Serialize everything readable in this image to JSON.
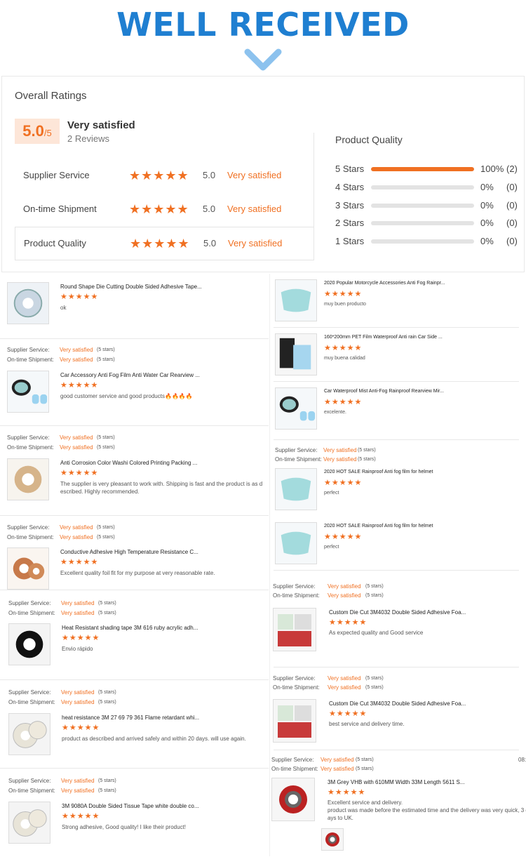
{
  "banner": {
    "title": "WELL RECEIVED"
  },
  "ratings": {
    "title": "Overall Ratings",
    "score": "5.0",
    "score_max": "/5",
    "summary": "Very satisfied",
    "review_count": "2 Reviews",
    "metrics": [
      {
        "label": "Supplier Service",
        "stars": "★★★★★",
        "score": "5.0",
        "text": "Very satisfied"
      },
      {
        "label": "On-time Shipment",
        "stars": "★★★★★",
        "score": "5.0",
        "text": "Very satisfied"
      },
      {
        "label": "Product Quality",
        "stars": "★★★★★",
        "score": "5.0",
        "text": "Very satisfied"
      }
    ],
    "product_quality": {
      "title": "Product Quality",
      "rows": [
        {
          "label": "5 Stars",
          "fraction": 1.0,
          "pct": "100%",
          "count": "(2)"
        },
        {
          "label": "4 Stars",
          "fraction": 0,
          "pct": "0%",
          "count": "(0)"
        },
        {
          "label": "3 Stars",
          "fraction": 0,
          "pct": "0%",
          "count": "(0)"
        },
        {
          "label": "2 Stars",
          "fraction": 0,
          "pct": "0%",
          "count": "(0)"
        },
        {
          "label": "1 Stars",
          "fraction": 0,
          "pct": "0%",
          "count": "(0)"
        }
      ]
    }
  },
  "review_meta": {
    "supplier_label": "Supplier Service:",
    "shipment_label": "On-time Shipment:",
    "value": "Very satisfied",
    "stars_count": "(5 stars)"
  },
  "reviews_left": [
    {
      "title": "Round Shape Die Cutting Double Sided Adhesive Tape...",
      "stars": "★★★★★",
      "comment": "ok"
    },
    {
      "title": "Car Accessory Anti Fog Film Anti Water Car Rearview ...",
      "stars": "★★★★★",
      "comment": "good customer service and good products🔥🔥🔥🔥"
    },
    {
      "title": "Anti Corrosion Color Washi Colored Printing Packing ...",
      "stars": "★★★★★",
      "comment": "The supplier is very pleasant to work with. Shipping is fast and the product is as d",
      "comment2": "escribed. Highly recommended."
    },
    {
      "title": "Conductive Adhesive High Temperature Resistance C...",
      "stars": "★★★★★",
      "comment": "Excellent quality foil fit for my purpose at very reasonable rate."
    },
    {
      "title": "Heat Resistant shading tape 3M 616 ruby acrylic adh...",
      "stars": "★★★★★",
      "comment": "Envio rápido"
    },
    {
      "title": "heat resistance 3M 27 69 79 361 Flame retardant whi...",
      "stars": "★★★★★",
      "comment": "product as described and arrived safely and within 20 days. will use again."
    },
    {
      "title": "3M 9080A Double Sided Tissue Tape white double co...",
      "stars": "★★★★★",
      "comment": "Strong adhesive, Good quality! I like their product!"
    }
  ],
  "reviews_right": [
    {
      "title": "2020 Popular Motorcycle Accessories Anti Fog Rainpr...",
      "stars": "★★★★★",
      "comment": "muy buen producto"
    },
    {
      "title": "160*200mm PET Film Waterproof Anti rain Car Side ...",
      "stars": "★★★★★",
      "comment": "muy buena calidad"
    },
    {
      "title": "Car Waterproof Mist Anti-Fog Rainproof Rearview Mir...",
      "stars": "★★★★★",
      "comment": "excelente."
    },
    {
      "title": "2020 HOT SALE Rainproof Anti fog film for helmet",
      "stars": "★★★★★",
      "comment": "perfect"
    },
    {
      "title": "2020 HOT SALE Rainproof Anti fog film for helmet",
      "stars": "★★★★★",
      "comment": "perfect"
    },
    {
      "title": "Custom Die Cut 3M4032 Double Sided Adhesive Foa...",
      "stars": "★★★★★",
      "comment": "As expected quality and Good service"
    },
    {
      "title": "Custom Die Cut 3M4032 Double Sided Adhesive Foa...",
      "stars": "★★★★★",
      "comment": "best service and delivery time."
    },
    {
      "title": "3M Grey VHB with 610MM Width 33M Length 5611 S...",
      "stars": "★★★★★",
      "comment": "Excellent service and delivery.",
      "comment2": "product was made before the estimated time and the delivery was very quick, 3 d",
      "comment3": "ays to UK.",
      "date": "08:"
    }
  ],
  "colors": {
    "accent": "#f07022",
    "banner": "#1f7fd1"
  }
}
